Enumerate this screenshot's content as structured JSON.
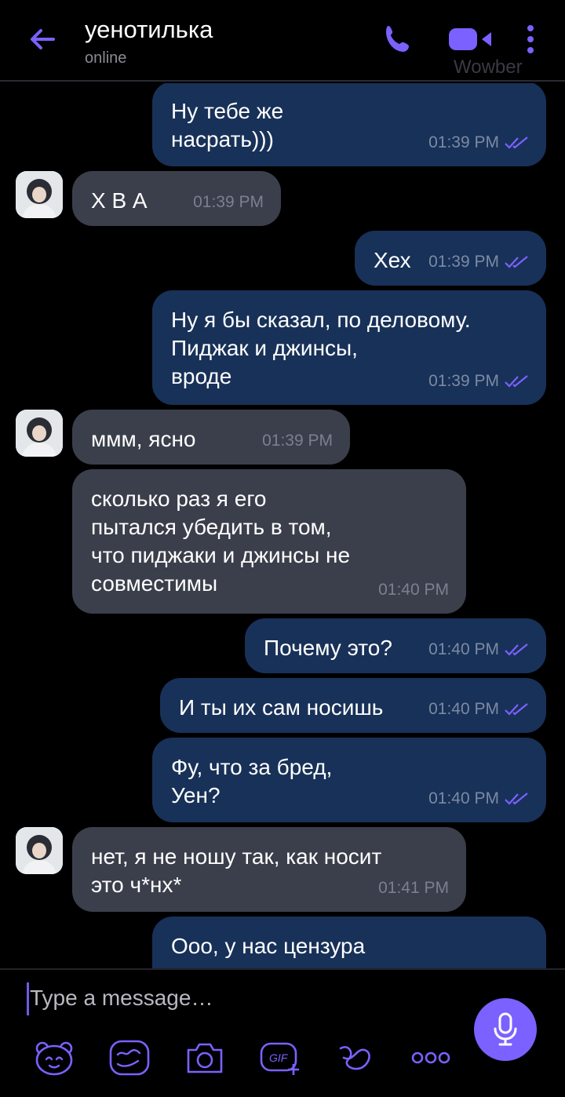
{
  "header": {
    "title": "уенотилька",
    "status": "online",
    "watermark": "Wowber"
  },
  "messages": [
    {
      "dir": "out",
      "text": "Ну тебе же\nнасрать)))",
      "time": "01:39 PM"
    },
    {
      "dir": "in",
      "text": "Х В А",
      "time": "01:39 PM"
    },
    {
      "dir": "out",
      "text": "Хех",
      "time": "01:39 PM"
    },
    {
      "dir": "out",
      "text": "Ну я бы сказал, по деловому.\nПиджак и джинсы,\nвроде",
      "time": "01:39 PM"
    },
    {
      "dir": "in",
      "text": "ммм, ясно",
      "time": "01:39 PM"
    },
    {
      "dir": "in",
      "text": "сколько раз я его\nпытался убедить в том,\nчто пиджаки и джинсы не\nсовместимы",
      "time": "01:40 PM"
    },
    {
      "dir": "out",
      "text": "Почему это?",
      "time": "01:40 PM"
    },
    {
      "dir": "out",
      "text": "И ты их сам носишь",
      "time": "01:40 PM"
    },
    {
      "dir": "out",
      "text": "Фу, что за бред,\nУен?",
      "time": "01:40 PM"
    },
    {
      "dir": "in",
      "text": "нет, я не ношу так, как носит\nэто ч*нх*",
      "time": "01:41 PM"
    },
    {
      "dir": "out",
      "text": "Ооо, у нас цензура",
      "time": ""
    }
  ],
  "composer": {
    "placeholder": "Type a message…"
  },
  "toolbar": {
    "icons": [
      "sticker-icon",
      "doodle-icon",
      "camera-icon",
      "gif-icon",
      "chat-extension-icon",
      "more-options-icon"
    ],
    "gif_label": "GIF"
  },
  "colors": {
    "accent": "#7b61ff",
    "outgoing_bubble": "#183158",
    "incoming_bubble": "#3b3f4b",
    "read_ticks": "#7b61ff"
  }
}
